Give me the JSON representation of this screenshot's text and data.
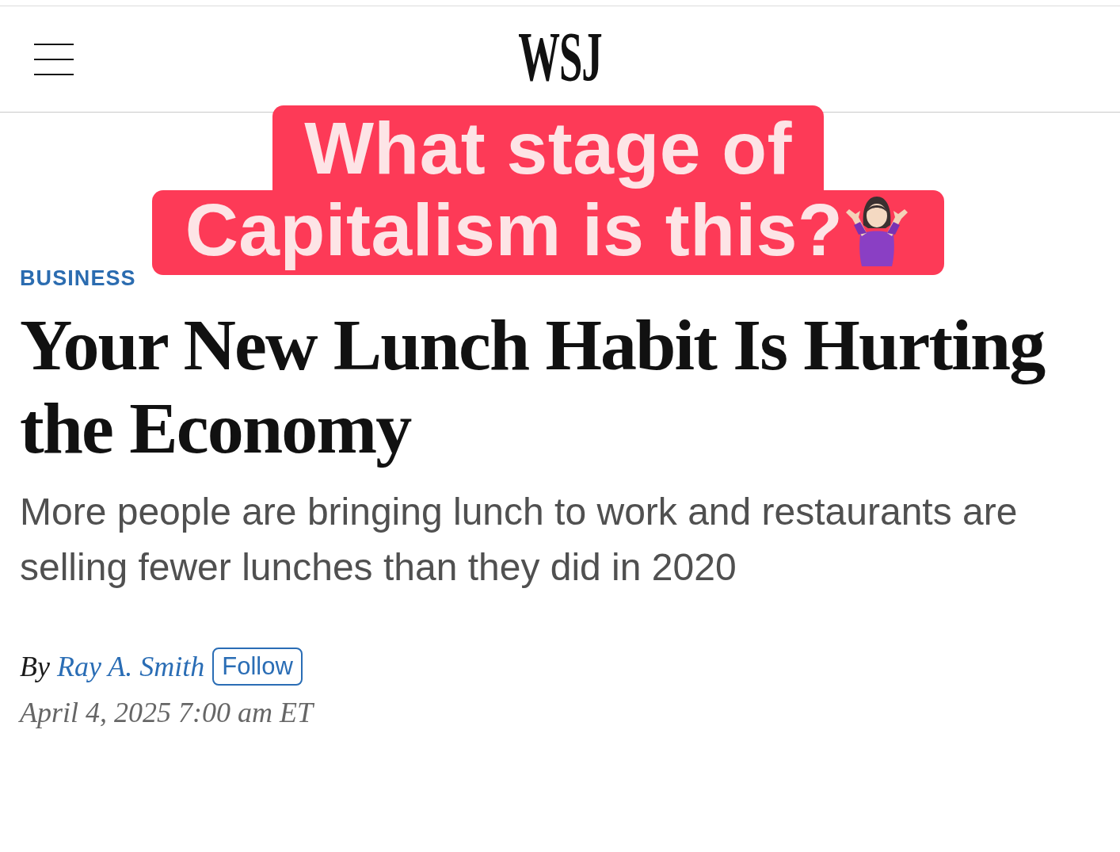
{
  "header": {
    "logo": "WSJ"
  },
  "overlay_caption": {
    "lines": [
      "What stage of",
      "Capitalism is this?"
    ]
  },
  "article": {
    "section": "BUSINESS",
    "headline": "Your New Lunch Habit Is Hurting the Economy",
    "subheadline": "More people are bringing lunch to work and restaurants are selling fewer lunches than they did in 2020",
    "byline": {
      "prefix": "By",
      "author": "Ray A. Smith",
      "follow_button": "Follow"
    },
    "timestamp": "April 4, 2025 7:00 am ET"
  }
}
